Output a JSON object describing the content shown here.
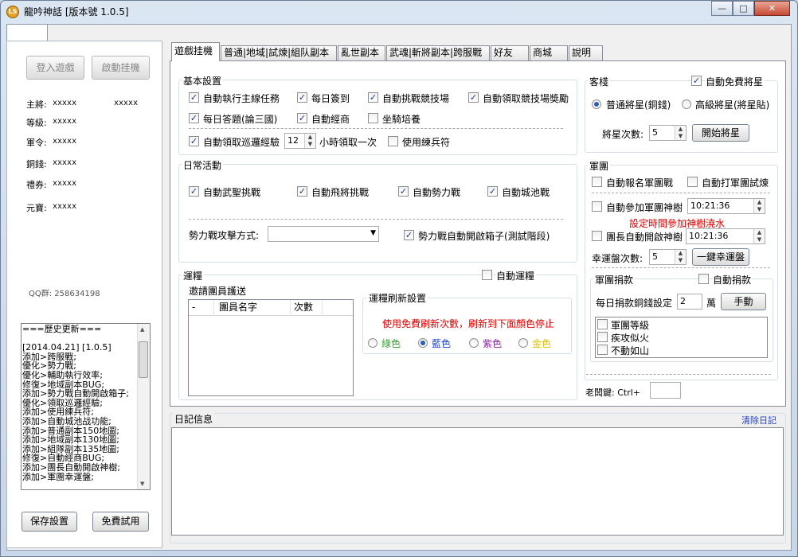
{
  "window": {
    "title": "龍吟神話 [版本號 1.0.5]",
    "icon_text": "LS"
  },
  "caption_buttons": {
    "minimize": "—",
    "maximize": "□",
    "close": "✕"
  },
  "left": {
    "login_button": "登入遊戲",
    "start_button": "啟動挂機",
    "fields": [
      {
        "label": "主將:",
        "value": "xxxxx",
        "value2": "xxxxx"
      },
      {
        "label": "等級:",
        "value": "xxxxx"
      },
      {
        "label": "軍令:",
        "value": "xxxxx"
      },
      {
        "label": "銅錢:",
        "value": "xxxxx"
      },
      {
        "label": "禮券:",
        "value": "xxxxx"
      },
      {
        "label": "元寶:",
        "value": "xxxxx"
      }
    ],
    "qq": "QQ群: 258634198",
    "history": [
      "===歷史更新===",
      "",
      "[2014.04.21]    [1.0.5]",
      "添加>跨服戰;",
      "優化>勢力戰;",
      "優化>輔助執行效率;",
      "修復>地域副本BUG;",
      "添加>勢力戰自動開啟箱子;",
      "優化>領取巡邏經驗;",
      "添加>使用練兵符;",
      "添加>自動城池战功能;",
      "添加>普通副本150地圖;",
      "添加>地域副本130地圖;",
      "添加>組隊副本135地圖;",
      "修復>自動經商BUG;",
      "添加>團長自動開啟神樹;",
      "添加>軍團幸運盤;"
    ],
    "save_button": "保存設置",
    "trial_button": "免費試用"
  },
  "tabs": [
    {
      "label": "遊戲挂機",
      "active": true
    },
    {
      "label": "普通|地域|試煉|組队副本",
      "active": false
    },
    {
      "label": "亂世副本",
      "active": false
    },
    {
      "label": "武魂|斬將副本|跨服戰",
      "active": false
    },
    {
      "label": "好友",
      "active": false
    },
    {
      "label": "商城",
      "active": false
    },
    {
      "label": "說明",
      "active": false
    }
  ],
  "basic": {
    "title": "基本設置",
    "auto_main_task": "自動執行主線任務",
    "daily_sign": "每日簽到",
    "auto_arena": "自動挑戰競技場",
    "auto_arena_reward": "自動領取競技場獎勵",
    "daily_quiz": "每日答題(論三國)",
    "auto_trade": "自動經商",
    "mount_train": "坐騎培養",
    "auto_patrol": "自動領取巡邏經驗",
    "patrol_hours": "12",
    "patrol_suffix": "小時領取一次",
    "use_train_token": "使用練兵符"
  },
  "daily": {
    "title": "日常活動",
    "auto_wusheng": "自動武聖挑戰",
    "auto_feijiang": "自動飛將挑戰",
    "auto_faction_war": "自動勢力戰",
    "auto_city_war": "自動城池戰",
    "attack_mode_label": "勢力戰攻擊方式:",
    "attack_mode_value": "",
    "auto_open_box": "勢力戰自動開啟箱子(測試階段)"
  },
  "escort": {
    "title": "運糧",
    "auto_escort": "自動運糧",
    "invite_label": "邀請團員護送",
    "columns": [
      "-",
      "團員名字",
      "次數"
    ],
    "refresh_title": "運糧刷新設置",
    "refresh_note": "使用免費刷新次數，刷新到下面顏色停止",
    "colors": [
      {
        "label": "綠色",
        "color": "#2ea02e",
        "selected": false
      },
      {
        "label": "藍色",
        "color": "#1a3fd8",
        "selected": true
      },
      {
        "label": "紫色",
        "color": "#8b1fa8",
        "selected": false
      },
      {
        "label": "金色",
        "color": "#e0c000",
        "selected": false
      }
    ]
  },
  "inn": {
    "title": "客棧",
    "auto_free": "自動免費將星",
    "normal": "普通將星(銅錢)",
    "advanced": "高級將星(將星貼)",
    "count_label": "將星次數:",
    "count_value": "5",
    "start_button": "開始將星"
  },
  "legion": {
    "title": "軍團",
    "auto_signup": "自動報名軍團戰",
    "auto_trial": "自動打軍團試煉",
    "auto_tree": "自動參加軍團神樹",
    "tree_time": "10:21:36",
    "tree_note": "設定時間參加神樹澆水",
    "leader_tree": "團長自動開啟神樹",
    "leader_time": "10:21:36",
    "lucky_label": "幸運盤次數:",
    "lucky_value": "5",
    "lucky_button": "一鍵幸運盤"
  },
  "donate": {
    "title": "軍團捐款",
    "auto_donate": "自動捐款",
    "daily_label": "每日捐款銅錢設定",
    "daily_value": "2",
    "unit": "萬",
    "manual_button": "手動",
    "items": [
      "軍團等級",
      "疾攻似火",
      "不動如山"
    ]
  },
  "hotkey": {
    "label": "老闆鍵: Ctrl+",
    "value": ""
  },
  "log": {
    "title": "日記信息",
    "clear": "清除日記"
  }
}
